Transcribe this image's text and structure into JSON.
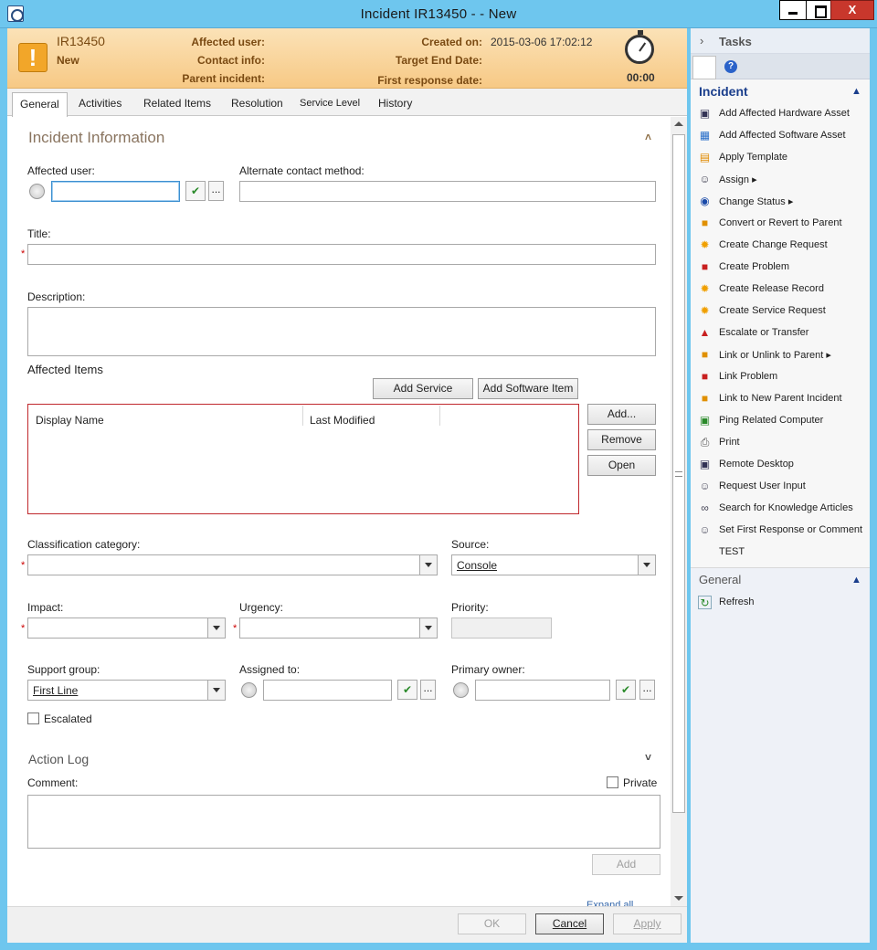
{
  "window": {
    "title": "Incident IR13450 -  - New",
    "close_label": "X"
  },
  "header": {
    "incident_id": "IR13450",
    "status": "New",
    "affected_user_label": "Affected user:",
    "contact_info_label": "Contact info:",
    "parent_incident_label": "Parent incident:",
    "created_on_label": "Created on:",
    "created_on_value": "2015-03-06 17:02:12",
    "target_end_date_label": "Target End Date:",
    "first_response_label": "First response date:",
    "timer": "00:00"
  },
  "tabs": [
    "General",
    "Activities",
    "Related Items",
    "Resolution",
    "Service Level",
    "History"
  ],
  "form": {
    "section_incident_info": "Incident Information",
    "affected_user_label": "Affected user:",
    "alt_contact_label": "Alternate contact method:",
    "title_label": "Title:",
    "description_label": "Description:",
    "affected_items_label": "Affected Items",
    "add_service": "Add Service",
    "add_software_item": "Add Software Item",
    "grid_columns": [
      "Display Name",
      "Last Modified"
    ],
    "grid_add": "Add...",
    "grid_remove": "Remove",
    "grid_open": "Open",
    "classification_label": "Classification category:",
    "source_label": "Source:",
    "source_value": "Console",
    "impact_label": "Impact:",
    "urgency_label": "Urgency:",
    "priority_label": "Priority:",
    "support_group_label": "Support group:",
    "support_group_value": "First Line",
    "assigned_to_label": "Assigned to:",
    "primary_owner_label": "Primary owner:",
    "escalated_label": "Escalated",
    "dots": "...",
    "required_mark": "*"
  },
  "action_log": {
    "title": "Action Log",
    "comment_label": "Comment:",
    "private_label": "Private",
    "add": "Add",
    "expand_all": "Expand all"
  },
  "footer": {
    "ok": "OK",
    "cancel": "Cancel",
    "apply": "Apply"
  },
  "tasks": {
    "title": "Tasks",
    "incident_section": "Incident",
    "items": [
      "Add Affected Hardware Asset",
      "Add Affected Software Asset",
      "Apply Template",
      "Assign",
      "Change Status",
      "Convert or Revert to Parent",
      "Create Change Request",
      "Create Problem",
      "Create Release Record",
      "Create Service Request",
      "Escalate or Transfer",
      "Link or Unlink to Parent",
      "Link Problem",
      "Link to New Parent Incident",
      "Ping Related Computer",
      "Print",
      "Remote Desktop",
      "Request User Input",
      "Search for Knowledge Articles",
      "Set First Response or Comment",
      "TEST"
    ],
    "general_section": "General",
    "refresh": "Refresh"
  },
  "colors": {
    "banner": "#f7c985",
    "titlebar": "#6ec6ee",
    "accent": "#1a3e8c",
    "required": "#cc0000"
  }
}
